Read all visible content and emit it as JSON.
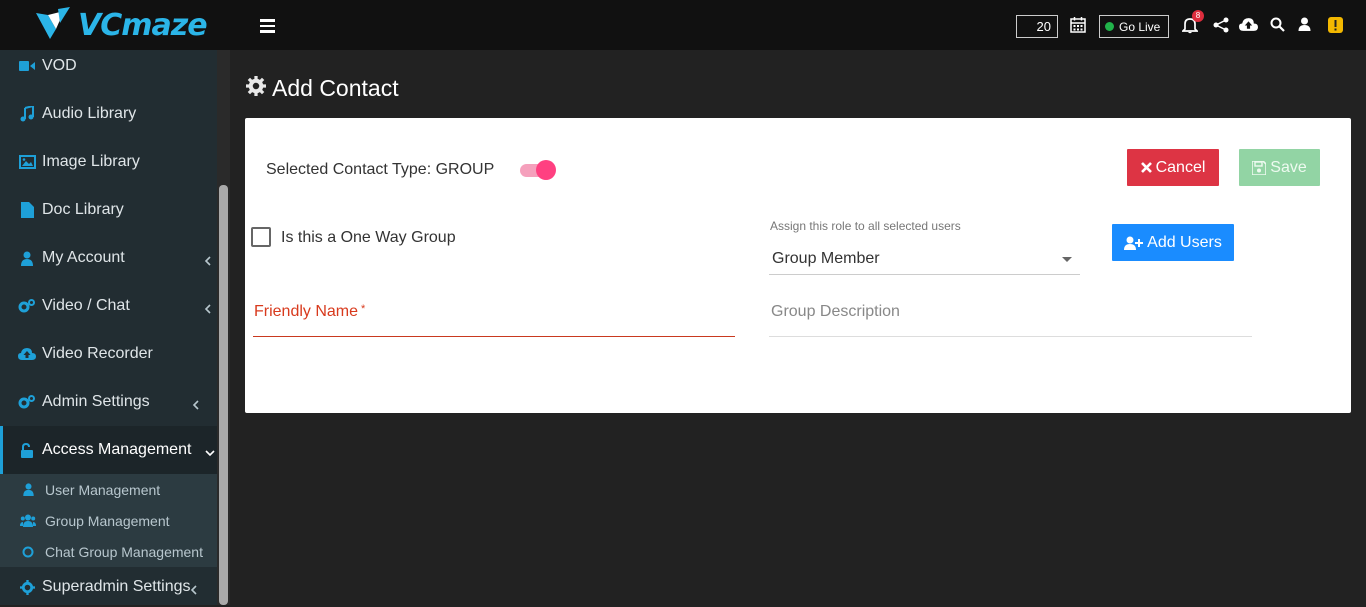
{
  "app": {
    "logo_text": "VCmaze"
  },
  "sidebar": {
    "items": [
      {
        "label": "VOD",
        "icon": "video-camera-icon"
      },
      {
        "label": "Audio Library",
        "icon": "music-note-icon"
      },
      {
        "label": "Image Library",
        "icon": "image-icon"
      },
      {
        "label": "Doc Library",
        "icon": "document-icon"
      },
      {
        "label": "My Account",
        "icon": "user-icon"
      },
      {
        "label": "Video / Chat",
        "icon": "gears-icon"
      },
      {
        "label": "Video Recorder",
        "icon": "cloud-upload-icon"
      },
      {
        "label": "Admin Settings",
        "icon": "gears-icon"
      },
      {
        "label": "Access Management",
        "icon": "unlock-icon"
      },
      {
        "label": "Superadmin Settings",
        "icon": "gear-icon"
      }
    ],
    "subitems": [
      {
        "label": "User Management",
        "icon": "user-icon"
      },
      {
        "label": "Group Management",
        "icon": "users-icon"
      },
      {
        "label": "Chat Group Management",
        "icon": "circle-icon"
      }
    ]
  },
  "topbar": {
    "count_value": "20",
    "go_live_label": "Go Live",
    "notification_count": "8"
  },
  "page": {
    "title": "Add Contact"
  },
  "form": {
    "contact_type_label": "Selected Contact Type: GROUP",
    "cancel_label": "Cancel",
    "save_label": "Save",
    "one_way_label": "Is this a One Way Group",
    "assign_role_label": "Assign this role to all selected users",
    "role_selected": "Group Member",
    "add_users_label": "Add Users",
    "friendly_name_label": "Friendly Name",
    "required_mark": "*",
    "group_description_label": "Group Description"
  },
  "colors": {
    "accent_blue": "#1a8cff",
    "cancel_red": "#dd3444",
    "save_green": "#92d4a4",
    "toggle_pink": "#ff4081",
    "sidebar_icon": "#1ea0d8"
  }
}
